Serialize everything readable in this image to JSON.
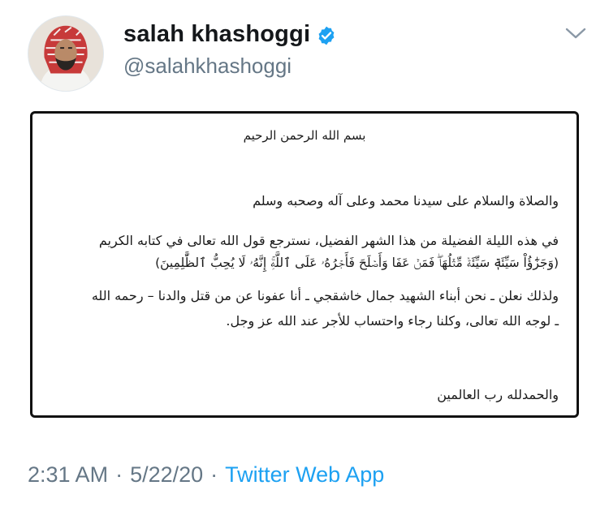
{
  "tweet": {
    "display_name": "salah khashoggi",
    "handle": "@salahkhashoggi",
    "verified": true,
    "time": "2:31 AM",
    "date": "5/22/20",
    "source": "Twitter Web App",
    "separator": "·",
    "icons": {
      "avatar": "profile-photo",
      "verified": "verified-badge-icon",
      "more": "chevron-down-icon"
    },
    "colors": {
      "verified": "#1da1f2",
      "link": "#1da1f2",
      "secondary_text": "#657786"
    }
  },
  "document": {
    "basmala": "بسم الله الرحمن الرحيم",
    "salutation": "والصلاة والسلام على سيدنا محمد وعلى آله وصحبه وسلم",
    "paragraph1_line1": "في هذه الليلة الفضيلة من هذا الشهر الفضيل، نسترجع قول الله تعالى في كتابه الكريم",
    "paragraph1_line2": "(وَجَزَٰٓؤُاْ سَيِّئَةٖ سَيِّئَةٞ مِّثۡلُهَاۖ فَمَنۡ عَفَا وَأَصۡلَحَ فَأَجۡرُهُۥ عَلَى ٱللَّهِۚ إِنَّهُۥ لَا يُحِبُّ ٱلظَّٰلِمِينَ)",
    "paragraph2_line1": "ولذلك نعلن ـ نحن أبناء الشهيد جمال خاشقجي ـ أنا عفونا عن من قتل والدنا – رحمه الله",
    "paragraph2_line2": "ـ لوجه الله تعالى، وكلنا رجاء واحتساب للأجر عند الله عز وجل.",
    "closing": "والحمدلله رب العالمين"
  }
}
